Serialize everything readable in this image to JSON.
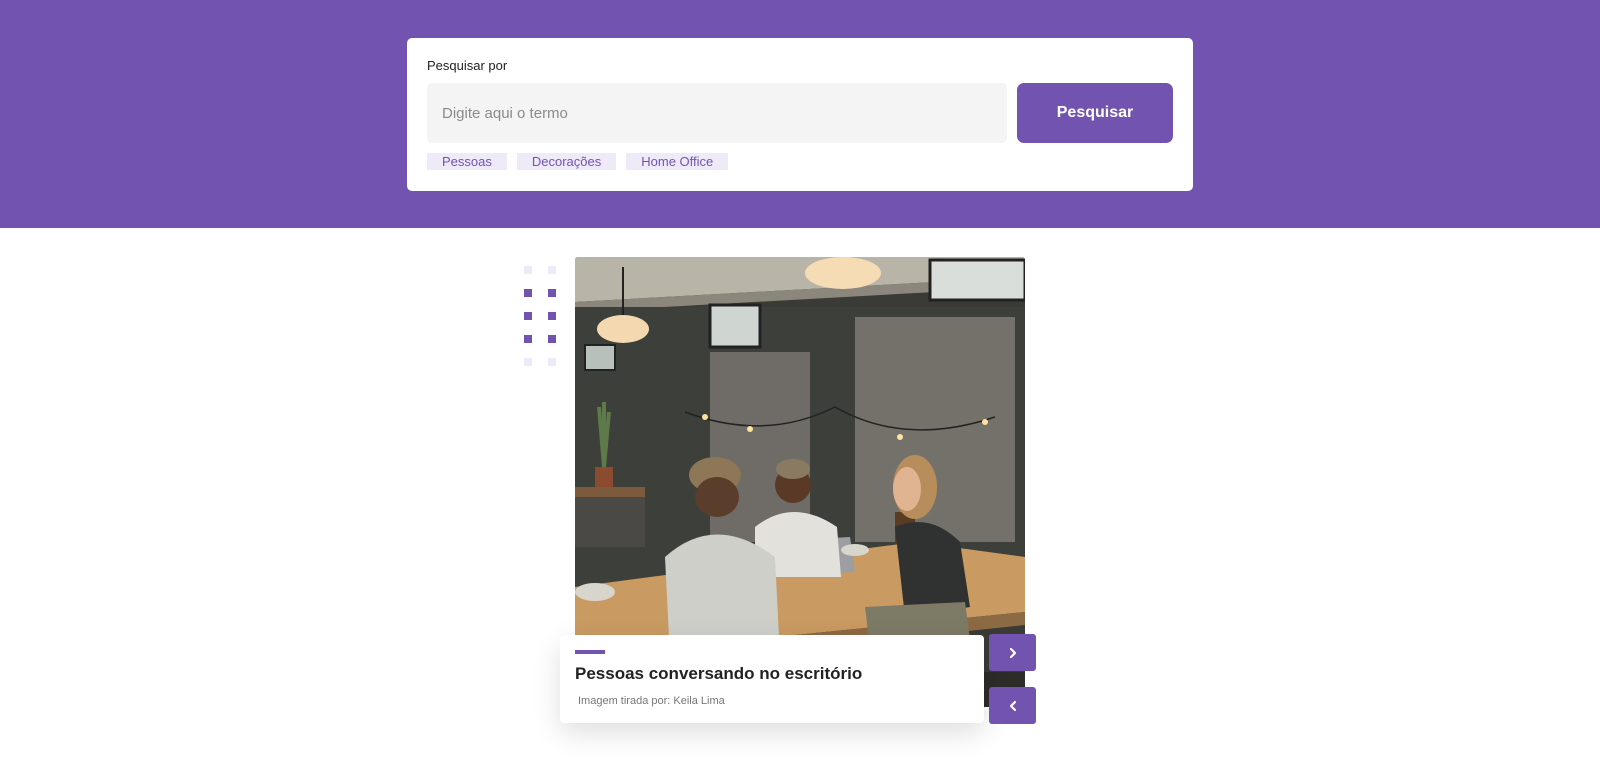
{
  "search": {
    "label": "Pesquisar por",
    "placeholder": "Digite aqui o termo",
    "value": "",
    "button_label": "Pesquisar",
    "tags": [
      "Pessoas",
      "Decorações",
      "Home Office"
    ]
  },
  "slide": {
    "title": "Pessoas conversando no escritório",
    "credit": "Imagem tirada por: Keila Lima",
    "image_alt": "People talking at a wooden table in an office"
  },
  "nav": {
    "next_icon": "chevron-right-icon",
    "prev_icon": "chevron-left-icon"
  },
  "colors": {
    "accent": "#7254b0",
    "tag_background": "#efeaf8"
  }
}
